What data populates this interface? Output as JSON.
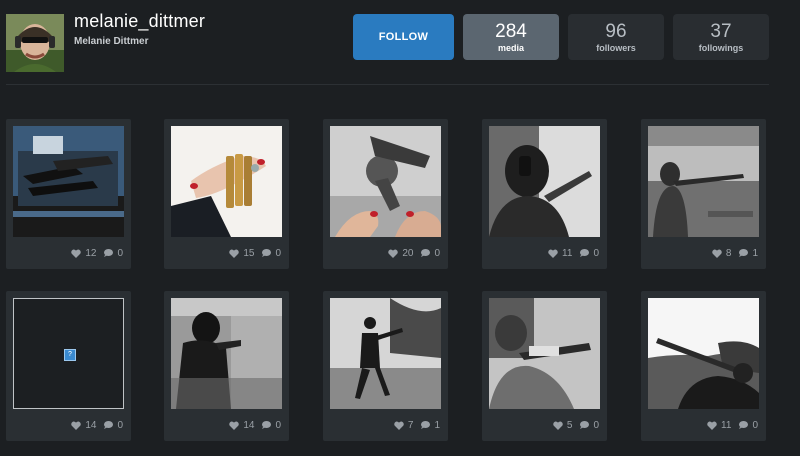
{
  "profile": {
    "username": "melanie_dittmer",
    "fullname": "Melanie Dittmer"
  },
  "actions": {
    "follow_label": "FOLLOW"
  },
  "stats": {
    "media": {
      "count": "284",
      "label": "media"
    },
    "followers": {
      "count": "96",
      "label": "followers"
    },
    "followings": {
      "count": "37",
      "label": "followings"
    }
  },
  "posts": [
    {
      "likes": "12",
      "comments": "0"
    },
    {
      "likes": "15",
      "comments": "0"
    },
    {
      "likes": "20",
      "comments": "0"
    },
    {
      "likes": "11",
      "comments": "0"
    },
    {
      "likes": "8",
      "comments": "1"
    },
    {
      "likes": "14",
      "comments": "0"
    },
    {
      "likes": "14",
      "comments": "0"
    },
    {
      "likes": "7",
      "comments": "1"
    },
    {
      "likes": "5",
      "comments": "0"
    },
    {
      "likes": "11",
      "comments": "0"
    }
  ],
  "broken_image_glyph": "?",
  "icons": {
    "like": "heart-icon",
    "comment": "comment-bubble-icon"
  },
  "colors": {
    "accent": "#2a7bc0",
    "background": "#1c1f22",
    "card": "#2a2f33"
  }
}
